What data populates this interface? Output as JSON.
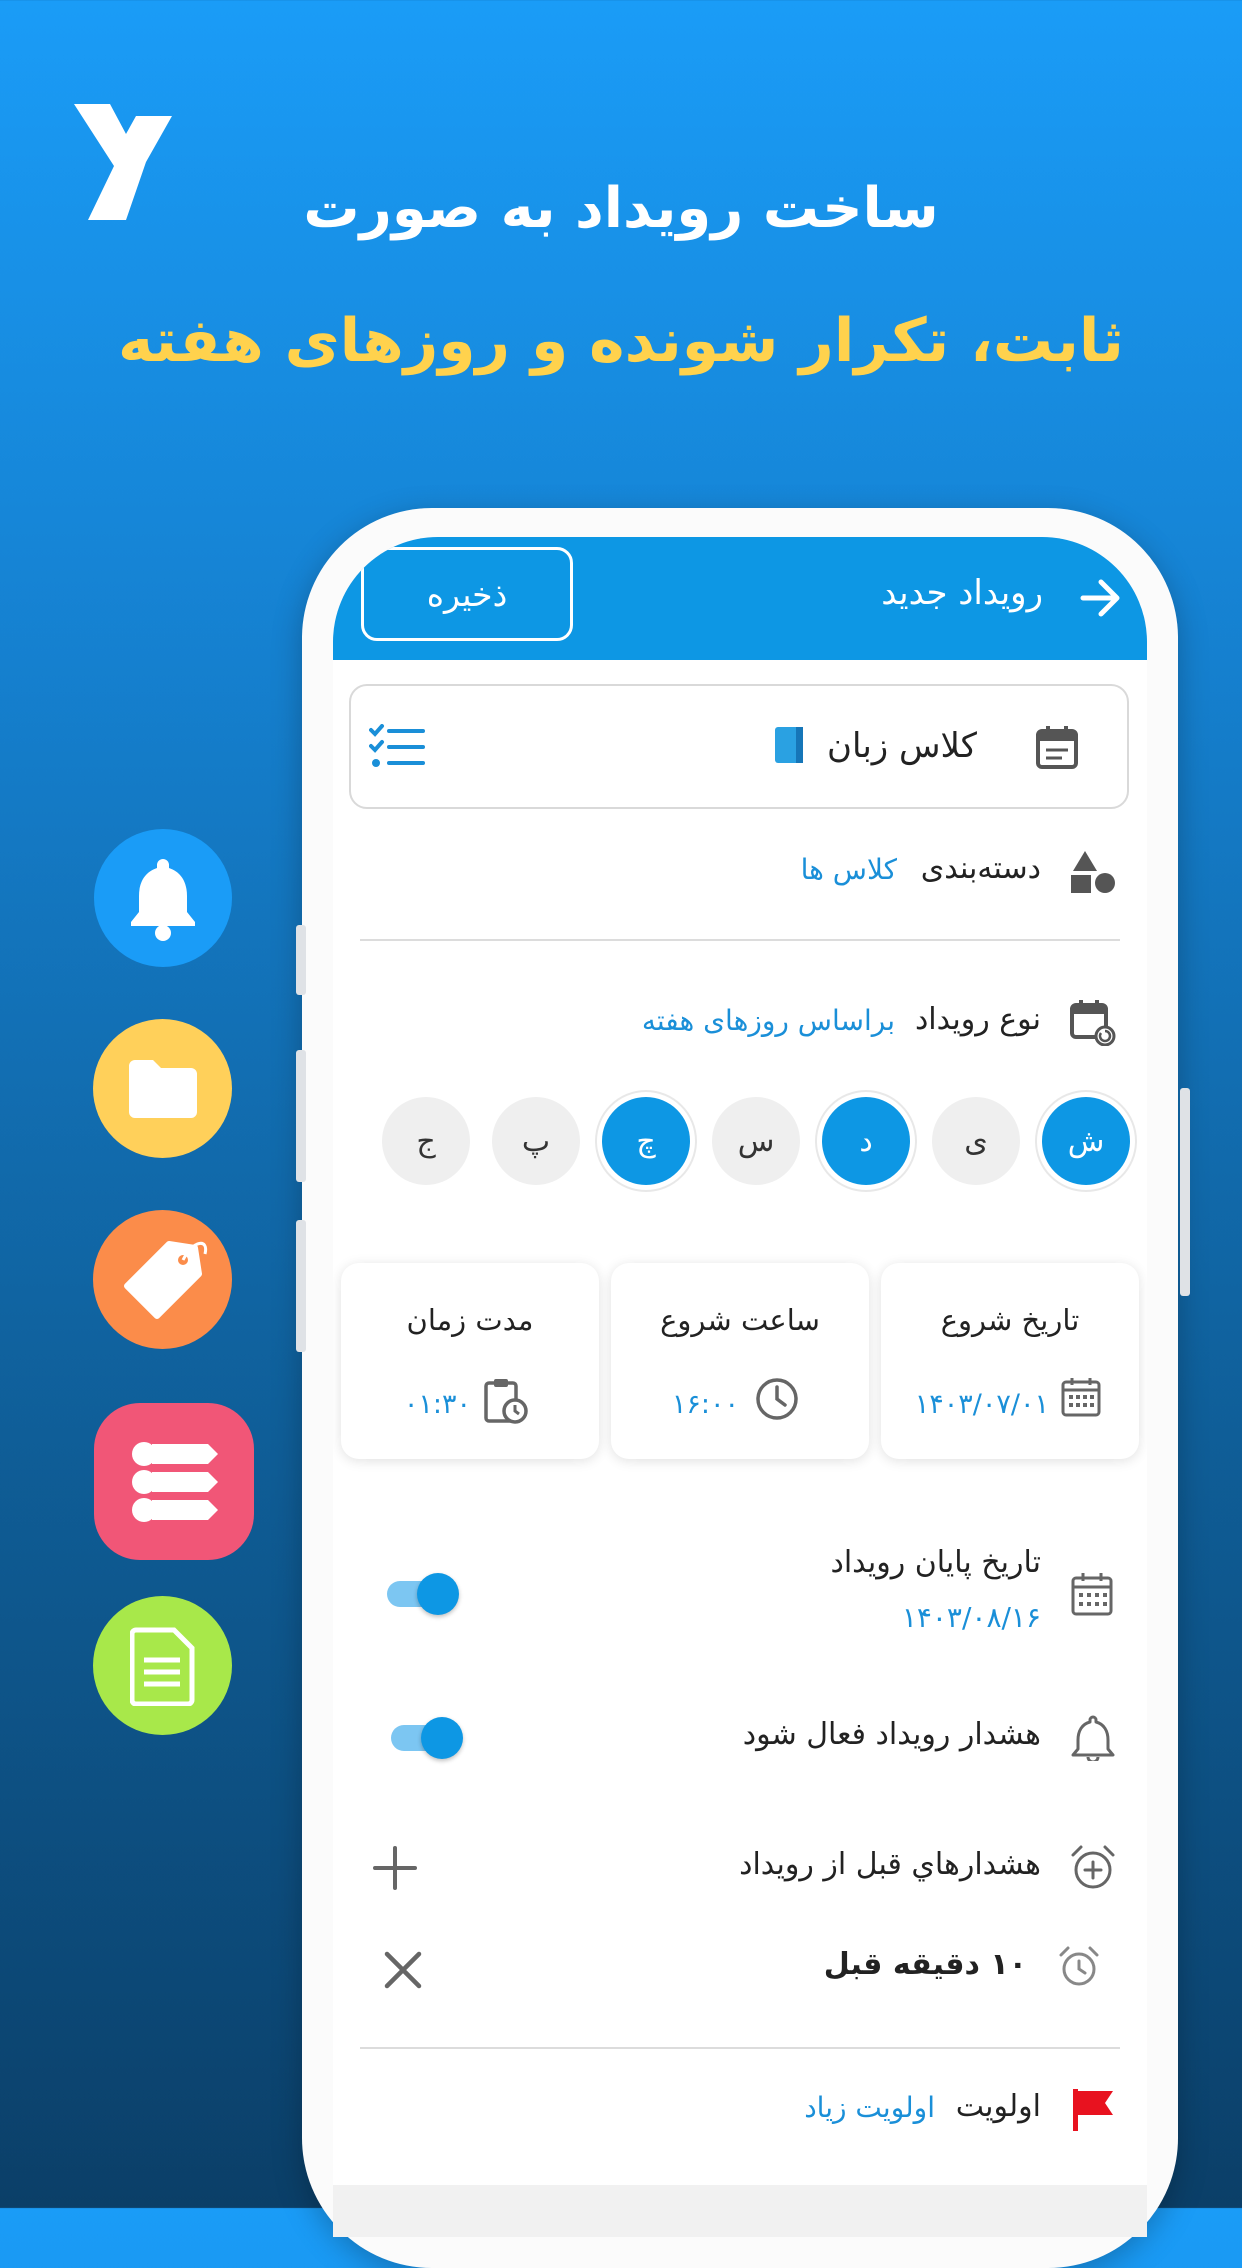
{
  "promo": {
    "headline_1": "ساخت رویداد به صورت",
    "headline_2": "ثابت، تکرار شونده و روزهای هفته"
  },
  "side_icons": [
    "bell-icon",
    "folder-icon",
    "tag-icon",
    "list-icon",
    "document-icon"
  ],
  "app_bar": {
    "title": "رویداد جدید",
    "save_label": "ذخیره"
  },
  "event": {
    "title_value": "کلاس زبان",
    "category_label": "دسته‌بندی",
    "category_value": "کلاس ها",
    "type_label": "نوع رویداد",
    "type_value": "براساس روزهای هفته"
  },
  "weekdays": [
    {
      "label": "ش",
      "selected": true
    },
    {
      "label": "ی",
      "selected": false
    },
    {
      "label": "د",
      "selected": true
    },
    {
      "label": "س",
      "selected": false
    },
    {
      "label": "چ",
      "selected": true
    },
    {
      "label": "پ",
      "selected": false
    },
    {
      "label": "ج",
      "selected": false
    }
  ],
  "cards": {
    "start_date_label": "تاریخ شروع",
    "start_date_value": "۱۴۰۳/۰۷/۰۱",
    "start_time_label": "ساعت شروع",
    "start_time_value": "۱۶:۰۰",
    "duration_label": "مدت زمان",
    "duration_value": "۰۱:۳۰"
  },
  "end_date": {
    "label": "تاریخ پایان رویداد",
    "value": "۱۴۰۳/۰۸/۱۶",
    "enabled": true
  },
  "alert": {
    "label": "هشدار رویداد فعال شود",
    "enabled": true
  },
  "pre_alerts": {
    "label": "هشدارهاي قبل از رویداد",
    "items": [
      {
        "label": "۱۰ دقیقه قبل"
      }
    ]
  },
  "priority": {
    "label": "اولویت",
    "value": "اولویت زیاد"
  },
  "colors": {
    "accent": "#0d97e4",
    "headline_yellow": "#ffd24d",
    "priority_flag": "#e8121f"
  }
}
